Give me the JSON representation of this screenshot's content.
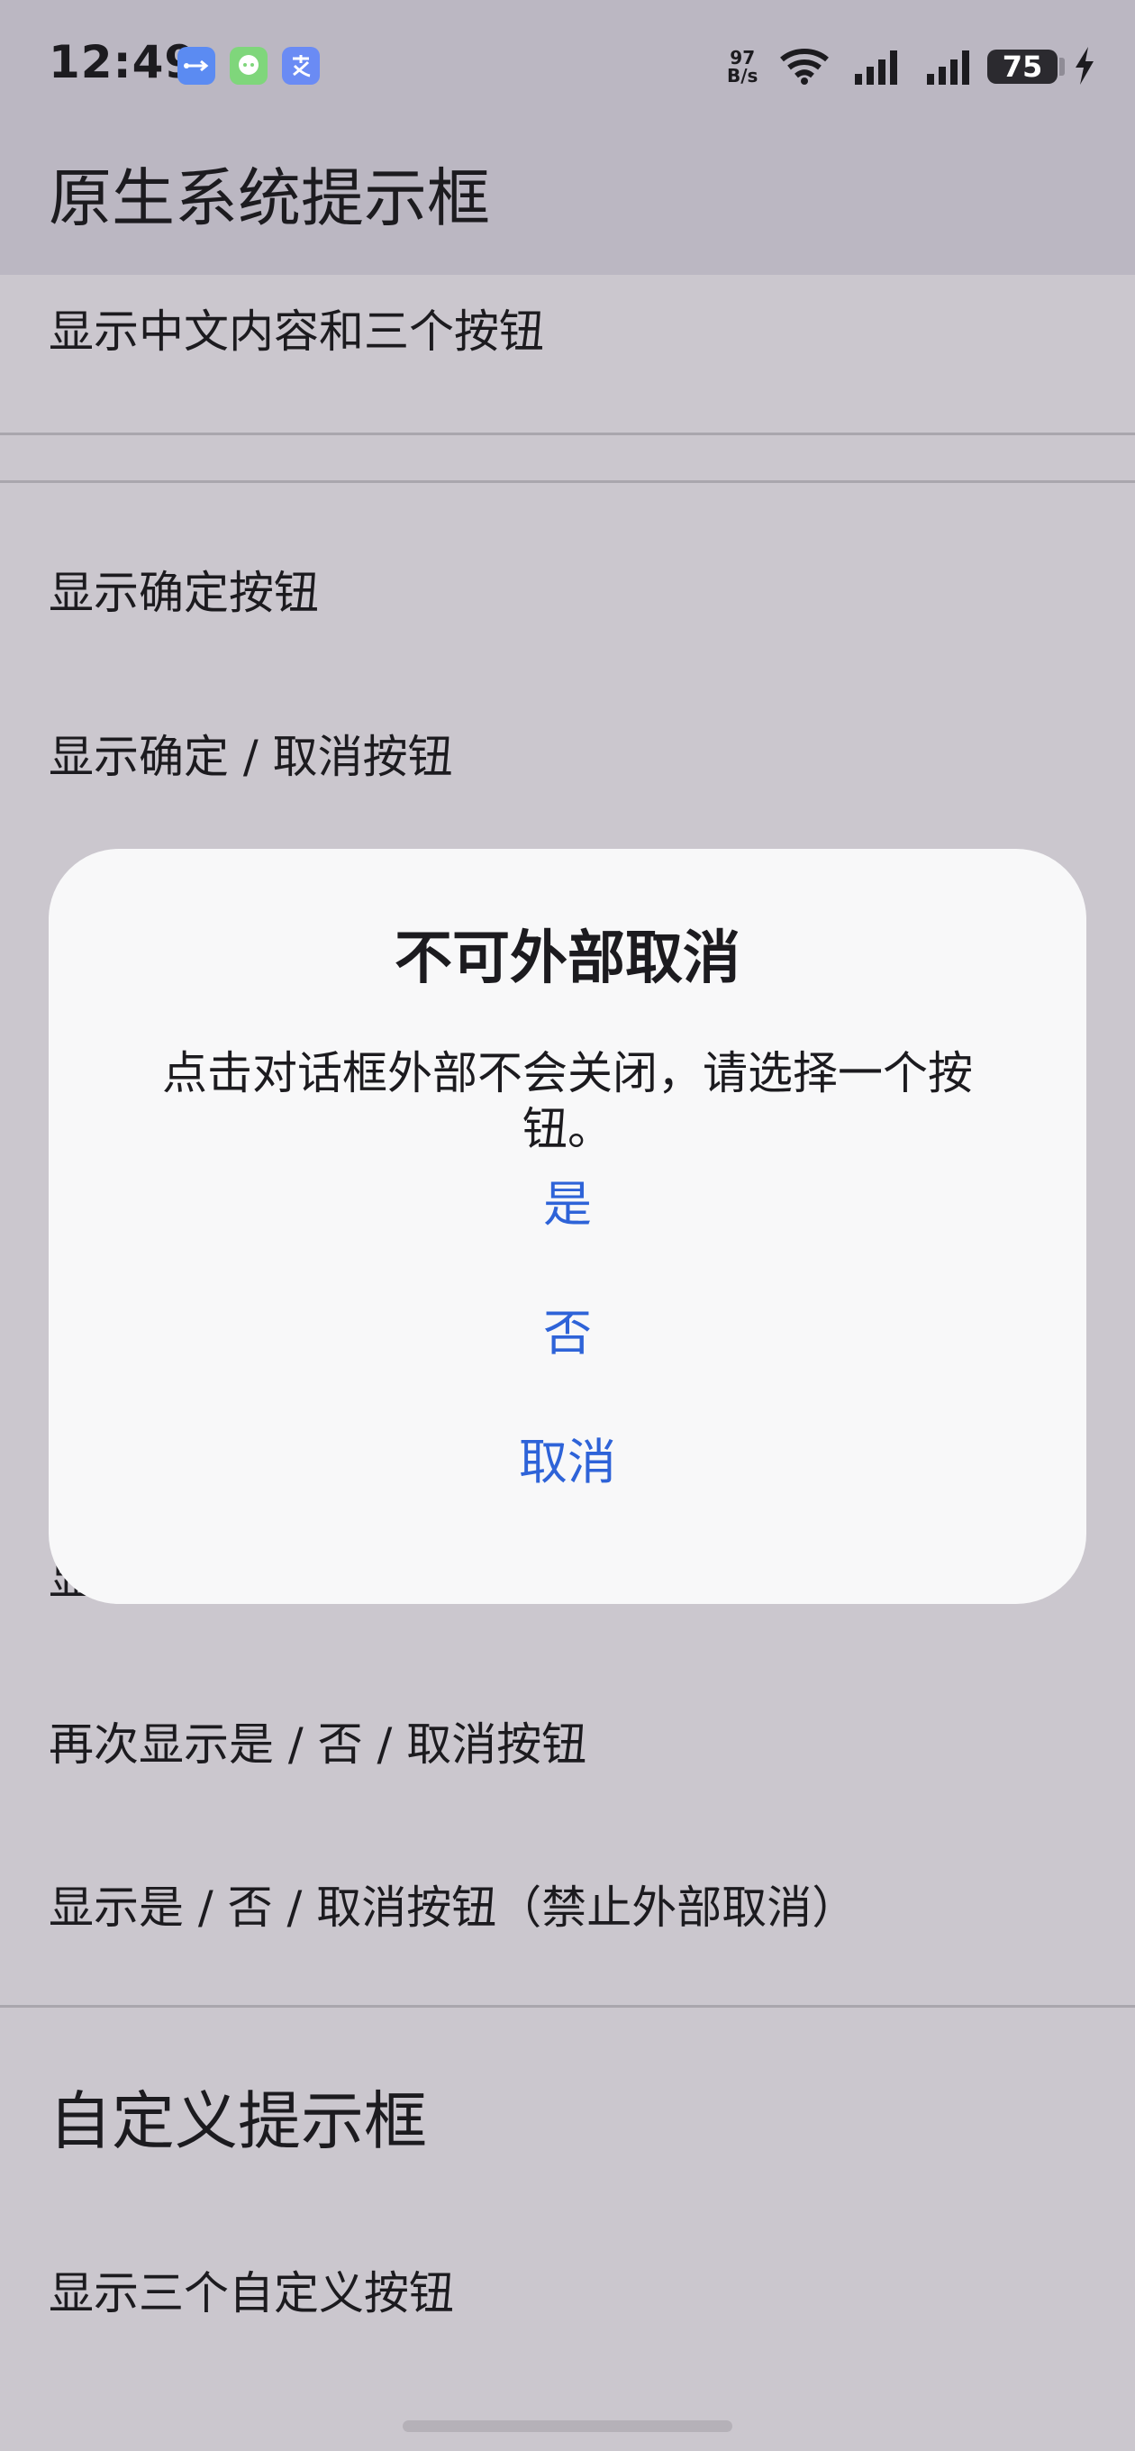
{
  "status_bar": {
    "time": "12:49",
    "net_speed_value": "97",
    "net_speed_unit": "B/s",
    "battery": "75",
    "icons": [
      "usb-icon",
      "chat-icon",
      "pay-icon",
      "wifi-icon",
      "signal-icon",
      "signal-icon",
      "battery-icon",
      "charging-icon"
    ]
  },
  "header": {
    "title": "原生系统提示框"
  },
  "list": {
    "item_top": "显示中文内容和三个按钮",
    "item_ok": "显示确定按钮",
    "item_ok_cancel": "显示确定 / 取消按钮",
    "partial_left": "显",
    "item_again": "再次显示是 / 否 / 取消按钮",
    "item_no_outside_cancel": "显示是 / 否 / 取消按钮（禁止外部取消）"
  },
  "custom_section": {
    "title": "自定义提示框",
    "item_three_custom": "显示三个自定义按钮"
  },
  "dialog": {
    "title": "不可外部取消",
    "message": "点击对话框外部不会关闭，请选择一个按钮。",
    "buttons": {
      "yes": "是",
      "no": "否",
      "cancel": "取消"
    },
    "accent_color": "#2e63d8"
  }
}
